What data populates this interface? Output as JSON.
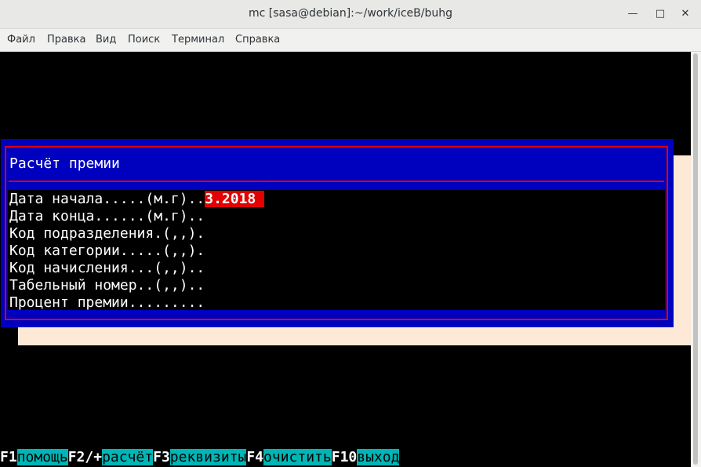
{
  "window": {
    "title": "mc [sasa@debian]:~/work/iceB/buhg"
  },
  "menu": [
    "Файл",
    "Правка",
    "Вид",
    "Поиск",
    "Терминал",
    "Справка"
  ],
  "dialog": {
    "title": "Расчёт премии",
    "rows": [
      {
        "label": "Дата начала.....(м.г)..",
        "value": "3.2018 "
      },
      {
        "label": "Дата конца......(м.г)..",
        "value": ""
      },
      {
        "label": "Код подразделения.(,,).",
        "value": ""
      },
      {
        "label": "Код категории.....(,,).",
        "value": ""
      },
      {
        "label": "Код начисления...(,,)..",
        "value": ""
      },
      {
        "label": "Табельный номер..(,,)..",
        "value": ""
      },
      {
        "label": "Процент премии.........",
        "value": ""
      }
    ]
  },
  "fkeys": [
    {
      "key": "F1",
      "label": "помощь"
    },
    {
      "key": "F2/+",
      "label": "расчёт"
    },
    {
      "key": "F3",
      "label": "реквизиты"
    },
    {
      "key": "F4",
      "label": "очистить"
    },
    {
      "key": "F10",
      "label": "выход"
    }
  ]
}
